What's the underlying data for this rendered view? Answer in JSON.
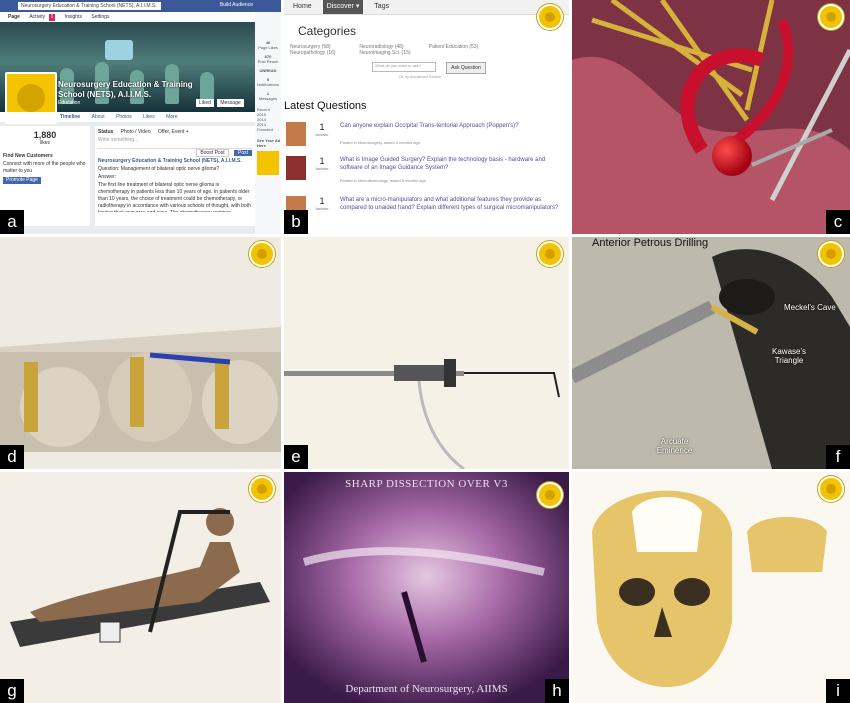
{
  "panel_labels": [
    "a",
    "b",
    "c",
    "d",
    "e",
    "f",
    "g",
    "h",
    "i"
  ],
  "panel_a": {
    "search_text": "Neurosurgery Education & Training School (NETS), A.I.I.M.S.",
    "top_tabs": [
      "Page",
      "Activity",
      "Insights",
      "Settings"
    ],
    "activity_badge": "1",
    "build_audience": "Build Audience",
    "page_title": "Neurosurgery Education & Training School (NETS), A.I.I.M.S.",
    "page_category": "Education",
    "nav_tabs": [
      "Timeline",
      "About",
      "Photos",
      "Likes",
      "More"
    ],
    "like_button": "Liked",
    "message_button": "Message",
    "composer_tabs": [
      "Status",
      "Photo / Video",
      "Offer, Event +"
    ],
    "composer_placeholder": "Write something...",
    "boost_label": "Boost Post",
    "post_button": "Post",
    "likes_count": "1,880",
    "likes_caption": "likes",
    "promo_heading": "Find New Customers",
    "promo_text": "Connect with more of the people who matter to you",
    "promote_button": "Promote Page",
    "post_author": "Neurosurgery Education & Training School (NETS), A.I.I.M.S.",
    "post_question": "Question: Management of bilateral optic nerve glioma?",
    "post_answer_label": "Answer:",
    "post_body": "The first line treatment of bilateral optic nerve glioma is chemotherapy in patients less than 10 years of age. In patients older than 10 years, the choice of treatment could be chemotherapy, or radiotherapy in accordance with various schools of thought, with both having their own pros and cons. The chemotherapy regimen suggested is ...",
    "side_stats": [
      {
        "value": "46",
        "label": "Page Likes"
      },
      {
        "value": "870",
        "label": "Post Reach"
      },
      {
        "value": "UNREAD",
        "label": ""
      },
      {
        "value": "5",
        "label": "Notifications"
      },
      {
        "value": "1",
        "label": "Messages"
      }
    ],
    "side_years": [
      "Recent",
      "2015",
      "2014",
      "2013",
      "Founded"
    ],
    "side_heading": "See Your Ad Here"
  },
  "panel_b": {
    "nav": [
      "Home",
      "Discover",
      "Tags"
    ],
    "categories_heading": "Categories",
    "categories": [
      "Neurosurgery (58)",
      "Neuroradiology (48)",
      "Patient Education (53)",
      "Neuropathology (16)",
      "Neuroimaging Sci. (15)",
      ""
    ],
    "ask_placeholder": "What do you want to ask?",
    "ask_button": "Ask Question",
    "advanced_search": "Or try Advanced Search",
    "latest_heading": "Latest Questions",
    "questions": [
      {
        "answers": "1",
        "answers_label": "Answer",
        "title": "Can anyone explain Occipital Trans-tentorial Approach (Poppen's)?",
        "meta": "Posted in Neurosurgery, asked 5 months ago"
      },
      {
        "answers": "1",
        "answers_label": "Answer",
        "title": "What is Image Guided Surgery? Explain the technology basis - hardware and software of an Image Guidance System?",
        "meta": "Posted in Neurotechnology, asked 5 months ago"
      },
      {
        "answers": "1",
        "answers_label": "Answer",
        "title": "What are a micro-manipulators and what additional features they provide as compared to unaided hand? Explain different types of surgical micromanipulators?",
        "meta": "Posted in Neurotechnology, asked 5 months ago"
      }
    ]
  },
  "panel_f": {
    "labels": [
      "Anterior Petrous Drilling",
      "Meckel's Cave",
      "Kawase's Triangle",
      "Arcuate Eminence"
    ]
  },
  "panel_h": {
    "title": "SHARP DISSECTION OVER V3",
    "footer": "Department of Neurosurgery, AIIMS"
  },
  "colors": {
    "facebook_blue": "#3b5998",
    "logo_yellow": "#f2c300",
    "vessel_red": "#c8102e",
    "panel_label_bg": "#000000"
  }
}
